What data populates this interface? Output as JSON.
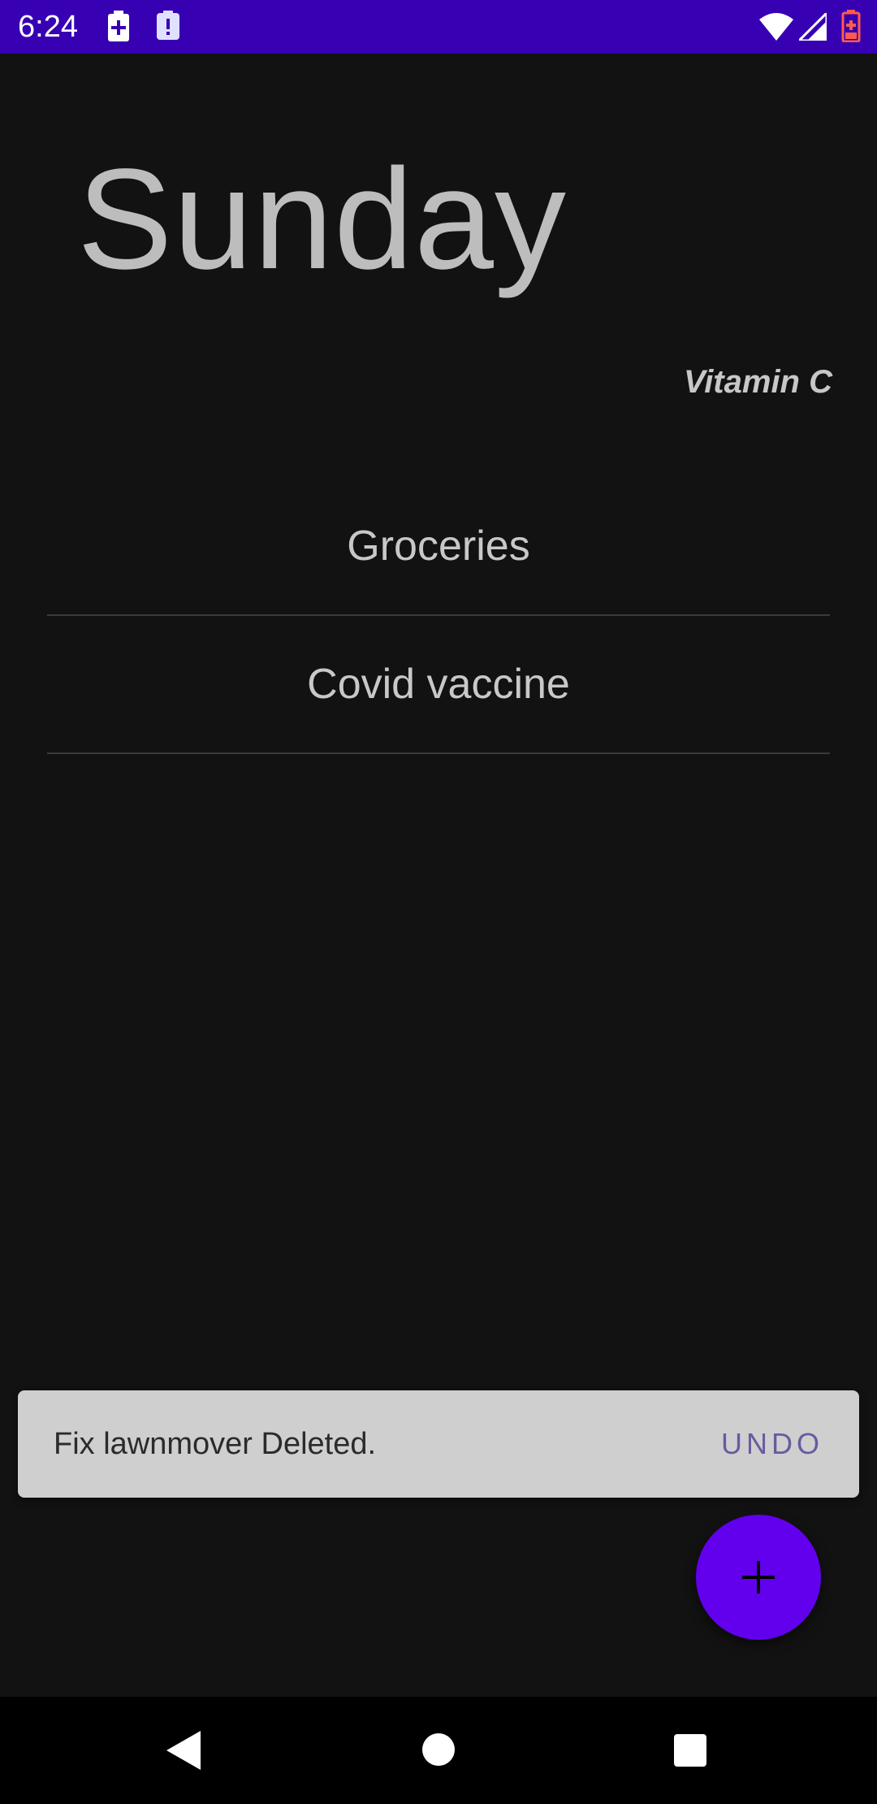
{
  "status_bar": {
    "time": "6:24",
    "icons": [
      "battery-saver-icon",
      "alert-clipboard-icon",
      "wifi-icon",
      "cell-signal-icon",
      "battery-low-icon"
    ],
    "background": "#3700b3"
  },
  "main": {
    "day_title": "Sunday",
    "subtitle": "Vitamin C",
    "tasks": [
      {
        "label": "Groceries"
      },
      {
        "label": "Covid vaccine"
      }
    ]
  },
  "snackbar": {
    "message": "Fix lawnmover Deleted.",
    "action": "UNDO"
  },
  "fab": {
    "icon": "plus-icon",
    "color": "#6200ee"
  },
  "nav_bar": {
    "icons": [
      "back-icon",
      "home-icon",
      "recents-icon"
    ]
  }
}
